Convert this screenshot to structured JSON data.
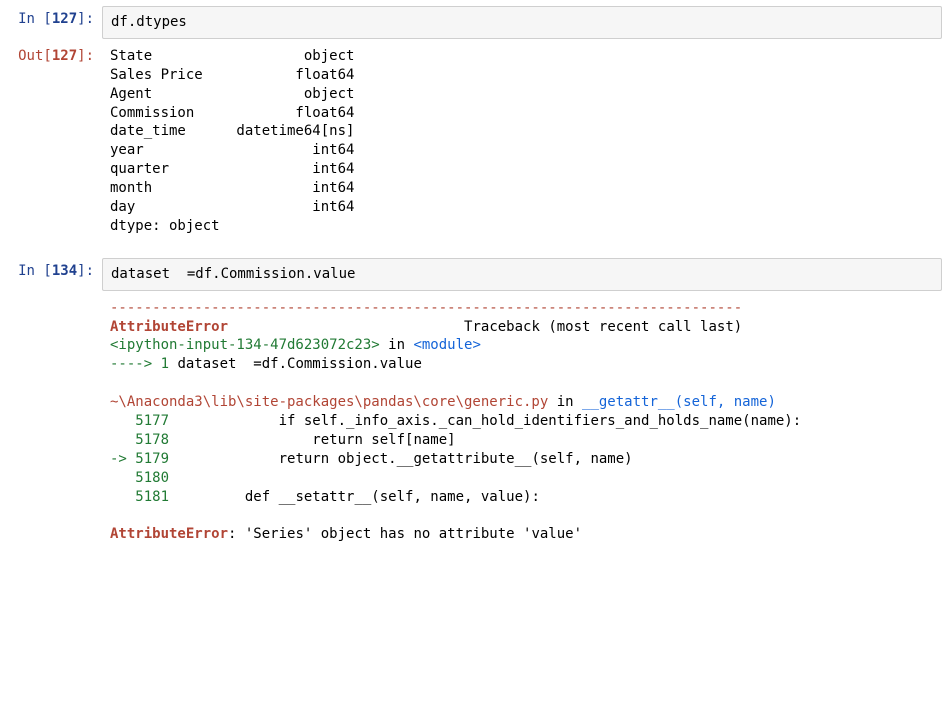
{
  "cells": {
    "c1": {
      "in_label": "In [",
      "in_num": "127",
      "in_label2": "]:",
      "code": "df.dtypes",
      "out_label": "Out[",
      "out_num": "127",
      "out_label2": "]:",
      "dtypes": {
        "l0": "State                  object",
        "l1": "Sales Price           float64",
        "l2": "Agent                  object",
        "l3": "Commission            float64",
        "l4": "date_time      datetime64[ns]",
        "l5": "year                    int64",
        "l6": "quarter                 int64",
        "l7": "month                   int64",
        "l8": "day                     int64",
        "l9": "dtype: object"
      }
    },
    "c2": {
      "in_label": "In [",
      "in_num": "134",
      "in_label2": "]:",
      "code": "dataset  =df.Commission.value",
      "dashes": "---------------------------------------------------------------------------",
      "err_name": "AttributeError",
      "tb_gap": "                            ",
      "tb_tail": "Traceback (most recent call last)",
      "loc1a": "<ipython-input-134-47d623072c23>",
      "loc1b": " in ",
      "loc1c": "<module>",
      "arrow1": "----> 1 ",
      "arrow1_code": "dataset  =df.Commission.value",
      "file2a": "~\\Anaconda3\\lib\\site-packages\\pandas\\core\\generic.py",
      "file2b": " in ",
      "file2c": "__getattr__",
      "file2d": "(self, name)",
      "p5177n": "   5177 ",
      "p5177c": "            if self._info_axis._can_hold_identifiers_and_holds_name(name):",
      "p5178n": "   5178 ",
      "p5178c": "                return self[name]",
      "p5179a": "-> 5179 ",
      "p5179c": "            return object.__getattribute__(self, name)",
      "p5180n": "   5180 ",
      "p5181n": "   5181 ",
      "p5181c": "        def __setattr__(self, name, value):",
      "final_err": "AttributeError",
      "final_msg": ": 'Series' object has no attribute 'value'"
    }
  }
}
